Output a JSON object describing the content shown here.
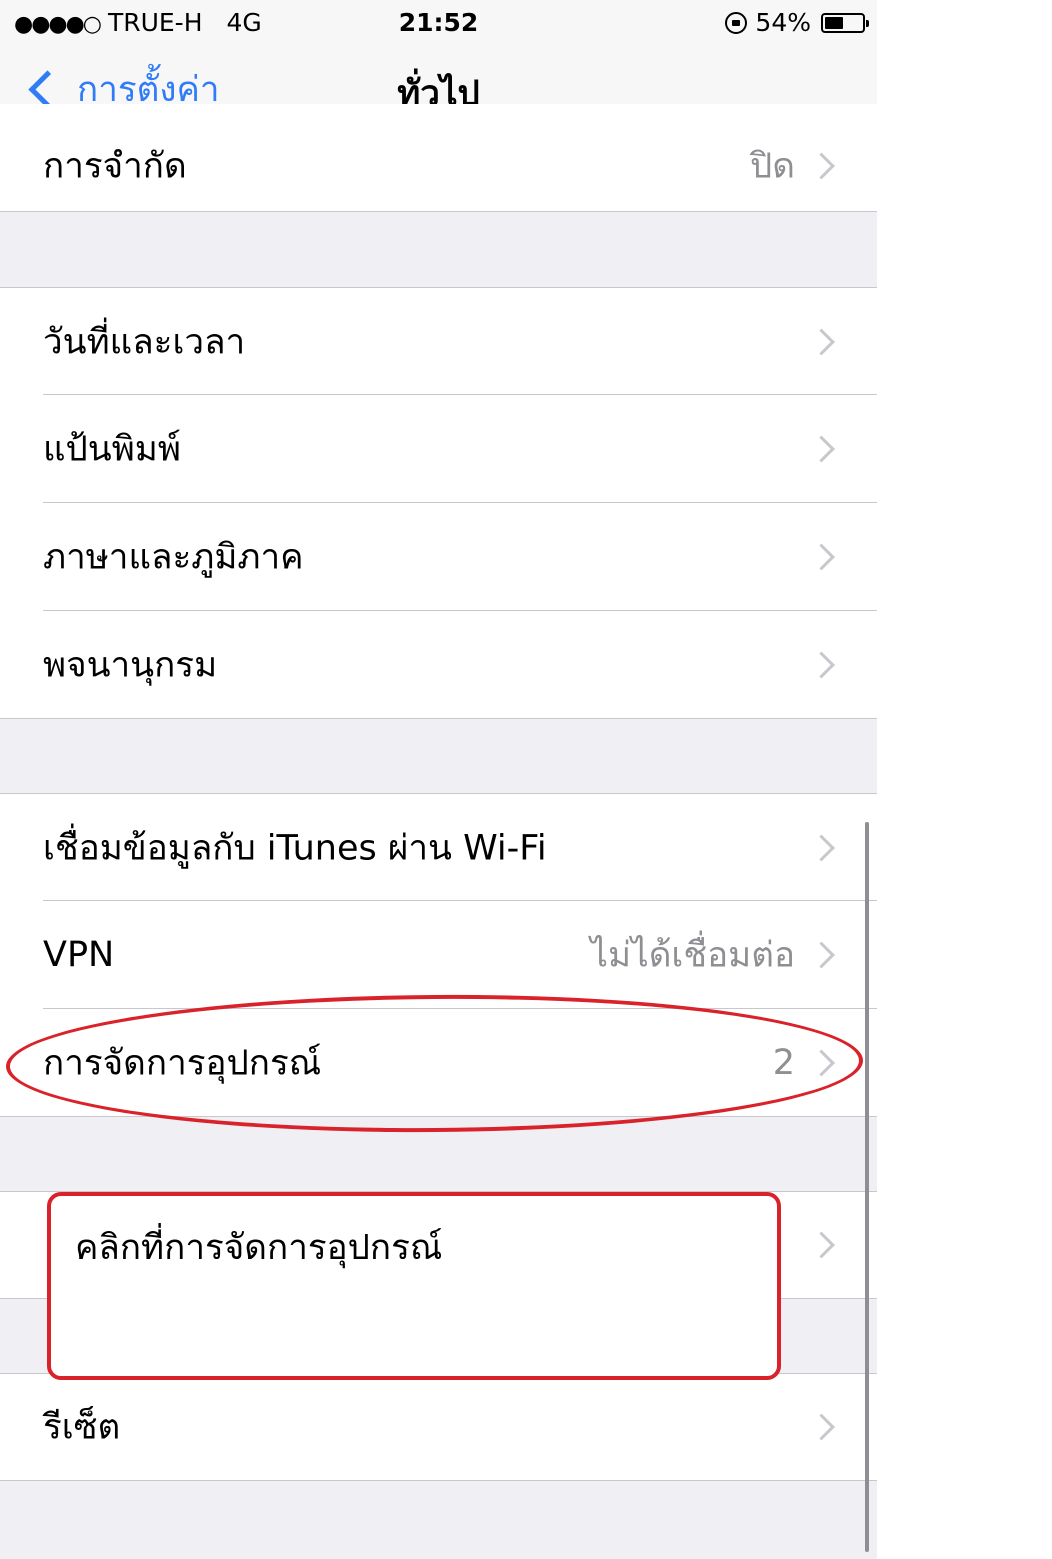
{
  "status_bar": {
    "signal": "●●●●○",
    "carrier": "TRUE-H",
    "network": "4G",
    "time": "21:52",
    "battery_percent": "54%",
    "battery_level": 0.54,
    "icons": [
      "orientation-lock-icon",
      "battery-icon"
    ]
  },
  "nav": {
    "back_label": "การตั้งค่า",
    "title": "ทั่วไป"
  },
  "rows": {
    "restrictions": {
      "label": "การจำกัด",
      "value": "ปิด"
    },
    "date_time": {
      "label": "วันที่และเวลา"
    },
    "keyboard": {
      "label": "แป้นพิมพ์"
    },
    "language_region": {
      "label": "ภาษาและภูมิภาค"
    },
    "dictionary": {
      "label": "พจนานุกรม"
    },
    "itunes_wifi_sync": {
      "label": "เชื่อมข้อมูลกับ iTunes ผ่าน Wi-Fi"
    },
    "vpn": {
      "label": "VPN",
      "value": "ไม่ได้เชื่อมต่อ"
    },
    "device_management": {
      "label": "การจัดการอุปกรณ์",
      "value": "2"
    },
    "hidden_row": {
      "label": ""
    },
    "reset": {
      "label": "รีเซ็ต"
    }
  },
  "annotation": {
    "text": "คลิกที่การจัดการอุปกรณ์",
    "color": "#d9222a"
  },
  "colors": {
    "accent": "#2f7cf6",
    "background": "#efeff4",
    "secondary_text": "#8e8e93"
  }
}
